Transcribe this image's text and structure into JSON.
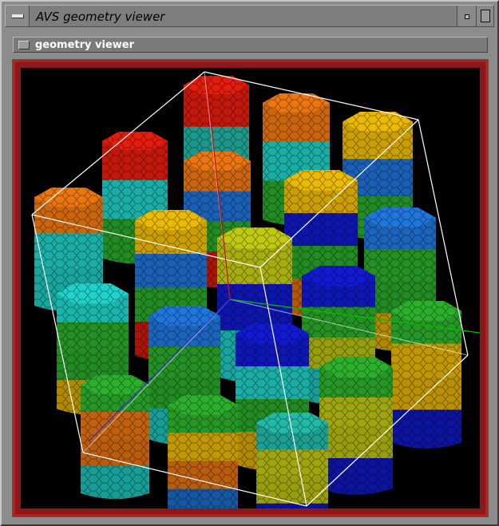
{
  "window": {
    "title": "AVS geometry viewer"
  },
  "panel": {
    "label": "geometry viewer"
  },
  "icons": {
    "window_menu": "window-menu-icon",
    "minimize": "minimize-icon",
    "maximize": "maximize-icon",
    "panel_toggle": "panel-toggle-icon"
  },
  "colors": {
    "frame_red": "#b22222",
    "viewport_bg": "#000000",
    "bounding_box": "#ffffff",
    "axis_x": "#00c000",
    "axis_y": "#d00000",
    "axis_z": "#3030d0"
  },
  "scene": {
    "description_type": "3D rendering of hexagonal pillar clusters in a rotated bounding cube",
    "pillar_color_palette": [
      "#d81b0c",
      "#1ec8c0",
      "#2aa82a",
      "#e0b000",
      "#1e6fd0",
      "#1018c8",
      "#e07010",
      "#b8c010"
    ]
  }
}
